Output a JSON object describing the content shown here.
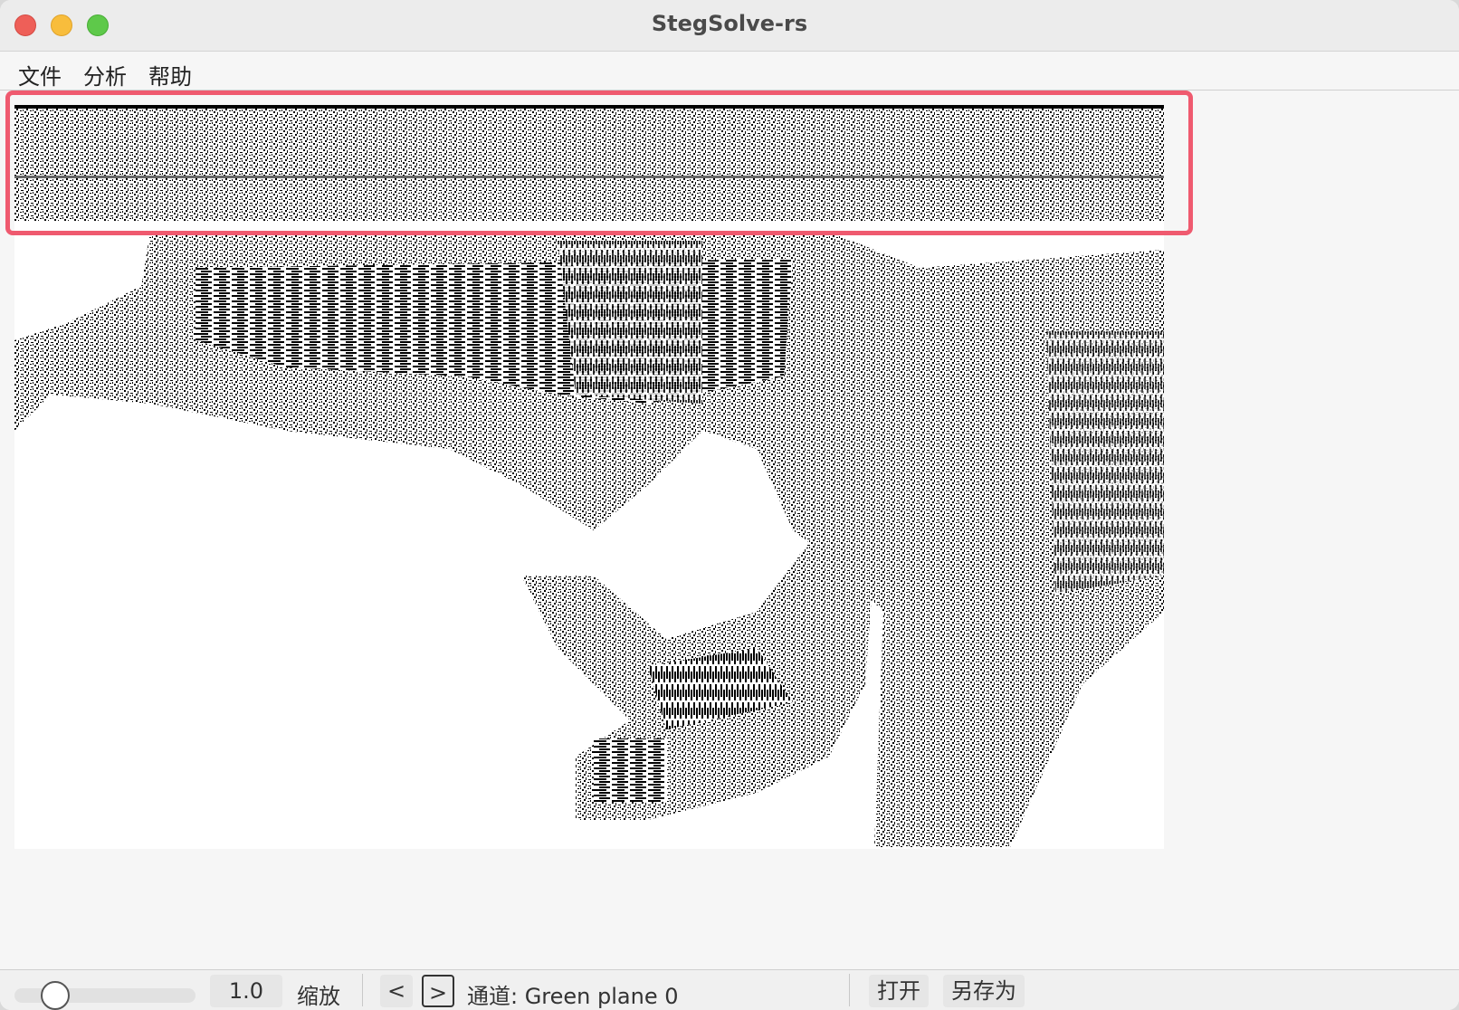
{
  "window": {
    "title": "StegSolve-rs"
  },
  "menu": {
    "items": [
      "文件",
      "分析",
      "帮助"
    ]
  },
  "statusbar": {
    "zoom_value": "1.0",
    "zoom_label": "缩放",
    "prev_label": "<",
    "next_label": ">",
    "channel_text": "通道: Green plane 0",
    "open_label": "打开",
    "save_as_label": "另存为",
    "zoom_slider_level": 0.2
  },
  "colors": {
    "highlight": "#ef5a6f",
    "close": "#ee5f58",
    "minimize": "#f8bd3c",
    "maximize": "#5ec94a"
  }
}
